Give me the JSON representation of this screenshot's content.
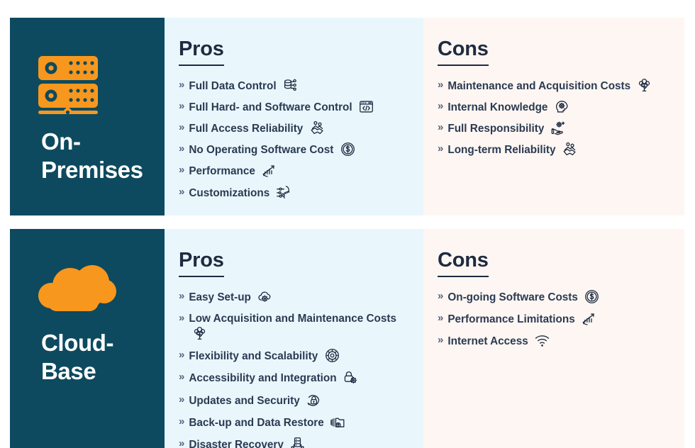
{
  "colors": {
    "panel_dark": "#0d4a5f",
    "accent_orange": "#f8971d",
    "pros_bg": "#e9f7fd",
    "cons_bg": "#fdf6f2",
    "text_dark": "#1e2b40",
    "page_bg": "#ffffff"
  },
  "rows": [
    {
      "id": "on-premises",
      "label": "On-\nPremises",
      "label_line1": "On-",
      "label_line2": "Premises",
      "icon": "server-icon",
      "pros": {
        "heading": "Pros",
        "items": [
          {
            "text": "Full Data Control",
            "icon": "database-network-icon"
          },
          {
            "text": "Full Hard- and Software Control",
            "icon": "code-window-icon"
          },
          {
            "text": "Full Access Reliability",
            "icon": "handshake-icon"
          },
          {
            "text": "No Operating Software Cost",
            "icon": "dollar-coin-icon"
          },
          {
            "text": "Performance",
            "icon": "bar-chart-growth-icon"
          },
          {
            "text": "Customizations",
            "icon": "hand-settings-icon"
          }
        ]
      },
      "cons": {
        "heading": "Cons",
        "items": [
          {
            "text": "Maintenance and Acquisition Costs",
            "icon": "money-tree-icon"
          },
          {
            "text": "Internal Knowledge",
            "icon": "head-gears-icon"
          },
          {
            "text": "Full Responsibility",
            "icon": "hand-gear-icon"
          },
          {
            "text": "Long-term Reliability",
            "icon": "handshake-icon"
          }
        ]
      }
    },
    {
      "id": "cloud-base",
      "label": "Cloud-\nBase",
      "label_line1": "Cloud-",
      "label_line2": "Base",
      "icon": "cloud-icon",
      "pros": {
        "heading": "Pros",
        "items": [
          {
            "text": "Easy Set-up",
            "icon": "cloud-gear-icon"
          },
          {
            "text": "Low Acquisition and Maintenance Costs",
            "icon": "money-tree-icon"
          },
          {
            "text": "Flexibility and Scalability",
            "icon": "gear-circle-icon"
          },
          {
            "text": "Accessibility and Integration",
            "icon": "lock-gear-icon"
          },
          {
            "text": "Updates and Security",
            "icon": "lock-refresh-icon"
          },
          {
            "text": "Back-up and Data Restore",
            "icon": "folder-restore-icon"
          },
          {
            "text": "Disaster Recovery",
            "icon": "server-hands-icon"
          }
        ]
      },
      "cons": {
        "heading": "Cons",
        "items": [
          {
            "text": "On-going Software Costs",
            "icon": "dollar-coin-icon"
          },
          {
            "text": "Performance Limitations",
            "icon": "bar-chart-growth-icon"
          },
          {
            "text": "Internet Access",
            "icon": "wifi-icon"
          }
        ]
      }
    }
  ],
  "bullet_marker": "»"
}
